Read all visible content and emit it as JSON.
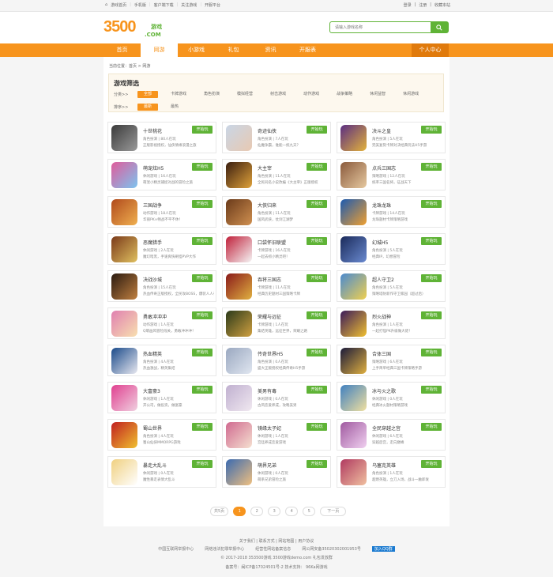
{
  "topbar": {
    "links": [
      "游戏首页",
      "手机版",
      "客户端下载",
      "关注游戏",
      "开服平台"
    ],
    "right": [
      "登录",
      "注册",
      "收藏本站"
    ]
  },
  "logo": {
    "num": "3500",
    "text": "游戏",
    "domain": ".COM"
  },
  "search": {
    "placeholder": "请输入游戏名称"
  },
  "nav": {
    "items": [
      "首页",
      "网游",
      "小游戏",
      "礼包",
      "资讯",
      "开服表"
    ],
    "user": "个人中心"
  },
  "breadcrumb": "当前位置：首页 > 网游",
  "filter": {
    "title": "游戏筛选",
    "cat_label": "分类>>",
    "cats": [
      "全部",
      "卡牌游戏",
      "角色扮演",
      "模拟经营",
      "射击游戏",
      "动作游戏",
      "战争策略",
      "休闲益智",
      "休闲游戏"
    ],
    "sort_label": "排序>>",
    "sorts": [
      "最新",
      "最热"
    ]
  },
  "play_label": "开始玩",
  "games": [
    {
      "name": "十世桃花",
      "meta": "角色扮演 | 80人在玩",
      "desc": "正版影视授权，仙侠情缘浪漫之旅",
      "c1": "#3a3a3a",
      "c2": "#9a9a9a"
    },
    {
      "name": "奇迹仙侠",
      "meta": "角色扮演 | 7人在玩",
      "desc": "仙魔争霸，谁能一统九天？",
      "c1": "#c9d6e6",
      "c2": "#e8c9b2"
    },
    {
      "name": "决斗之皇",
      "meta": "角色扮演 | 5人在玩",
      "desc": "完美复刻卡牌对决经典玩法H5手游",
      "c1": "#5a2d82",
      "c2": "#e3b23c"
    },
    {
      "name": "萌宠炫H5",
      "meta": "休闲游戏 | 16人在玩",
      "desc": "萌宠小精灵捕捉对战的冒险之旅",
      "c1": "#e05c9b",
      "c2": "#7cc4f0"
    },
    {
      "name": "大主宰",
      "meta": "角色扮演 | 11人在玩",
      "desc": "全民同名小说改编《大主宰》正版授权",
      "c1": "#3a1e10",
      "c2": "#e0a23a"
    },
    {
      "name": "点兵三国志",
      "meta": "策略游戏 | 12人在玩",
      "desc": "统率三国名将，征战天下",
      "c1": "#8a5a3c",
      "c2": "#e6c9a0"
    },
    {
      "name": "三国战争",
      "meta": "动作游戏 | 18人在玩",
      "desc": "华丽PK×畅战不平不休！",
      "c1": "#b04a1c",
      "c2": "#f0b050"
    },
    {
      "name": "大侠归来",
      "meta": "角色扮演 | 11人在玩",
      "desc": "国风武侠，仗剑江湖梦",
      "c1": "#6a3a1a",
      "c2": "#d09050"
    },
    {
      "name": "龙珠龙珠",
      "meta": "卡牌游戏 | 14人在玩",
      "desc": "龙珠题材卡牌策略游戏",
      "c1": "#1c5ab0",
      "c2": "#f0a030"
    },
    {
      "name": "恶魔猎手",
      "meta": "休闲游戏 | 2人在玩",
      "desc": "魔幻暗黑，手速爽快刷怪PVP大作",
      "c1": "#7a3a1a",
      "c2": "#e0c060"
    },
    {
      "name": "口袋怀旧联盟",
      "meta": "卡牌游戏 | 16人在玩",
      "desc": "一起去抓小精灵吧！",
      "c1": "#c0203a",
      "c2": "#f5f5f5"
    },
    {
      "name": "幻城H5",
      "meta": "角色扮演 | 5人在玩",
      "desc": "经典IP，幻想冒险",
      "c1": "#1a2a5a",
      "c2": "#6a8ad0"
    },
    {
      "name": "决战沙城",
      "meta": "角色扮演 | 15人在玩",
      "desc": "热血传奇正版授权，全民攻BOSS，爆装人人有",
      "c1": "#2a1a10",
      "c2": "#c08040"
    },
    {
      "name": "吞将三国志",
      "meta": "卡牌游戏 | 11人在玩",
      "desc": "经典历史题材三国策略卡牌",
      "c1": "#8a1a1a",
      "c2": "#e0b040"
    },
    {
      "name": "超人守卫2",
      "meta": "角色扮演 | 5人在玩",
      "desc": "策略塔防新作守卫家园（超过后）",
      "c1": "#4a8ad0",
      "c2": "#f0d050"
    },
    {
      "name": "勇敢冲冲冲",
      "meta": "动作游戏 | 1人在玩",
      "desc": "Q萌画风冒险闯关，勇敢冲冲冲！",
      "c1": "#e080b0",
      "c2": "#f8e0b0"
    },
    {
      "name": "荣耀与远征",
      "meta": "卡牌游戏 | 1人在玩",
      "desc": "集结英雄，远征世界，荣耀之路",
      "c1": "#2a3a1a",
      "c2": "#d0a040"
    },
    {
      "name": "烈火战神",
      "meta": "角色扮演 | 1人在玩",
      "desc": "一起打怪PK升级做大佬！",
      "c1": "#3a1a5a",
      "c2": "#f0c030"
    },
    {
      "name": "热血精英",
      "meta": "角色扮演 | 4人在玩",
      "desc": "热血激战，精英集结",
      "c1": "#1a4a8a",
      "c2": "#e8e8f0"
    },
    {
      "name": "传奇世界H5",
      "meta": "角色扮演 | 0人在玩",
      "desc": "盛大正版授权经典传奇H5手游",
      "c1": "#9aa8c0",
      "c2": "#e0e6f0"
    },
    {
      "name": "合体三国",
      "meta": "策略游戏 | 6人在玩",
      "desc": "上手简单经典三国卡牌策略手游",
      "c1": "#1a1a3a",
      "c2": "#e0b040"
    },
    {
      "name": "大富豪3",
      "meta": "休闲游戏 | 1人在玩",
      "desc": "开公司，做投资，做富豪",
      "c1": "#e04090",
      "c2": "#f0d0e0"
    },
    {
      "name": "美男有毒",
      "meta": "休闲游戏 | 0人在玩",
      "desc": "古风恋爱养成，攻略美男",
      "c1": "#c0b0d0",
      "c2": "#f0e8f0"
    },
    {
      "name": "冰与火之歌",
      "meta": "休闲游戏 | 0人在玩",
      "desc": "经典冰火题材策略游戏",
      "c1": "#4080c0",
      "c2": "#f0e0a0"
    },
    {
      "name": "蜀山世界",
      "meta": "角色扮演 | 4人在玩",
      "desc": "蜀山仙侠MMORPG游戏",
      "c1": "#c02020",
      "c2": "#f0c030"
    },
    {
      "name": "镜缘太子妃",
      "meta": "休闲游戏 | 1人在玩",
      "desc": "宫廷养成恋爱游戏",
      "c1": "#d06a90",
      "c2": "#f5e0d0"
    },
    {
      "name": "全民穿越之宫",
      "meta": "休闲游戏 | 6人在玩",
      "desc": "穿越后宫，走向巅峰",
      "c1": "#a05aa0",
      "c2": "#f0d0f0"
    },
    {
      "name": "暴走大乱斗",
      "meta": "休闲游戏 | 0人在玩",
      "desc": "魔性暴走表情大乱斗",
      "c1": "#f0d080",
      "c2": "#ffffff"
    },
    {
      "name": "萌界兄弟",
      "meta": "休闲游戏 | 0人在玩",
      "desc": "萌系兄弟冒险之旅",
      "c1": "#3a6ab0",
      "c2": "#f0c080"
    },
    {
      "name": "乌塞克英雄",
      "meta": "角色扮演 | 1人在玩",
      "desc": "超燃英雄，立刀入场，战斗一触即发",
      "c1": "#b03a60",
      "c2": "#f0c0a0"
    }
  ],
  "pager": [
    "共5页",
    "1",
    "2",
    "3",
    "4",
    "5",
    "下一页"
  ],
  "footer": {
    "links": "关于我们  |  联系方式  |  网站地图  |  用户协议",
    "badges": [
      "中国互联网举报中心",
      "网络违法犯罪举报中心",
      "经营性网站备案信息",
      "网公网安备35020302001953号",
      "加入QQ群"
    ],
    "copyright": "© 2017-2018  353500游戏  3500游戏demo.com  礼包发放群",
    "icp": "备案号：闽ICP备17024501号-2   技术支持：  96Ka网游戏"
  }
}
